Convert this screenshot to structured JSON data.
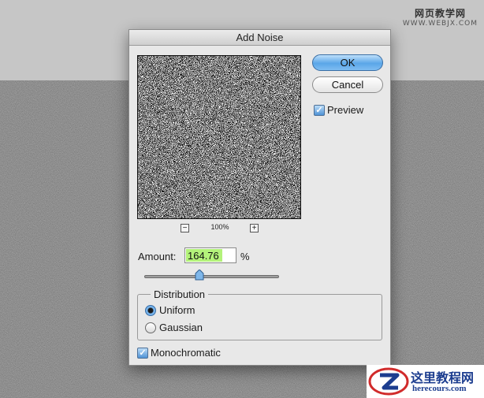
{
  "watermark_top": {
    "line1": "网页教学网",
    "line2": "WWW.WEBJX.COM"
  },
  "dialog": {
    "title": "Add Noise",
    "ok_label": "OK",
    "cancel_label": "Cancel",
    "preview_label": "Preview",
    "preview_checked": true,
    "zoom_minus": "−",
    "zoom_plus": "+",
    "zoom_level": "100%",
    "amount_label": "Amount:",
    "amount_value": "164.76",
    "amount_unit": "%",
    "amount_slider_fraction": 0.41,
    "distribution_label": "Distribution",
    "distribution_options": [
      "Uniform",
      "Gaussian"
    ],
    "distribution_selected": "Uniform",
    "monochromatic_label": "Monochromatic",
    "monochromatic_checked": true
  },
  "watermark_bottom": {
    "line1": "这里教程网",
    "line2": "herecours.com"
  },
  "colors": {
    "ok_button": "#5aa6e8",
    "amount_highlight": "#b3f27a",
    "dialog_bg": "#e8e8e8",
    "canvas_bg": "#2f2f2f"
  },
  "icons": {
    "checkmark": "check-icon",
    "slider": "slider-thumb-icon"
  }
}
